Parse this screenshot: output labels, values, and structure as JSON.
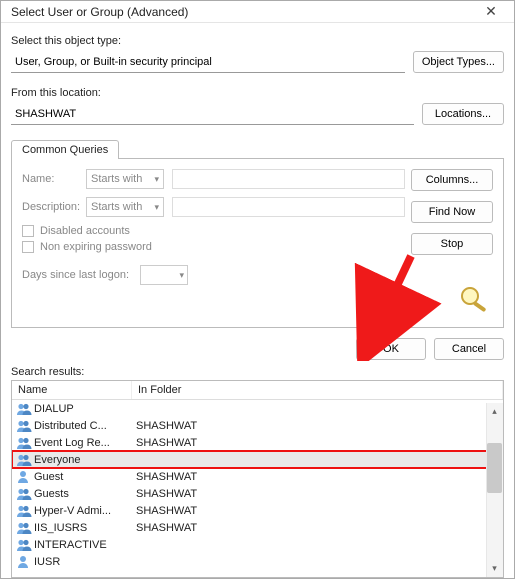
{
  "title": "Select User or Group (Advanced)",
  "labels": {
    "object_type": "Select this object type:",
    "from_location": "From this location:",
    "common_queries_tab": "Common Queries",
    "name": "Name:",
    "description": "Description:",
    "starts_with": "Starts with",
    "disabled_accounts": "Disabled accounts",
    "non_expiring": "Non expiring password",
    "days_since": "Days since last logon:",
    "search_results": "Search results:",
    "col_name": "Name",
    "col_folder": "In Folder"
  },
  "values": {
    "object_type": "User, Group, or Built-in security principal",
    "location": "SHASHWAT"
  },
  "buttons": {
    "object_types": "Object Types...",
    "locations": "Locations...",
    "columns": "Columns...",
    "find_now": "Find Now",
    "stop": "Stop",
    "ok": "OK",
    "cancel": "Cancel"
  },
  "results": [
    {
      "name": "DIALUP",
      "folder": "",
      "icon": "group",
      "selected": false,
      "highlight": false
    },
    {
      "name": "Distributed C...",
      "folder": "SHASHWAT",
      "icon": "group",
      "selected": false,
      "highlight": false
    },
    {
      "name": "Event Log Re...",
      "folder": "SHASHWAT",
      "icon": "group",
      "selected": false,
      "highlight": false
    },
    {
      "name": "Everyone",
      "folder": "",
      "icon": "group",
      "selected": true,
      "highlight": true
    },
    {
      "name": "Guest",
      "folder": "SHASHWAT",
      "icon": "user",
      "selected": false,
      "highlight": false
    },
    {
      "name": "Guests",
      "folder": "SHASHWAT",
      "icon": "group",
      "selected": false,
      "highlight": false
    },
    {
      "name": "Hyper-V Admi...",
      "folder": "SHASHWAT",
      "icon": "group",
      "selected": false,
      "highlight": false
    },
    {
      "name": "IIS_IUSRS",
      "folder": "SHASHWAT",
      "icon": "group",
      "selected": false,
      "highlight": false
    },
    {
      "name": "INTERACTIVE",
      "folder": "",
      "icon": "group",
      "selected": false,
      "highlight": false
    },
    {
      "name": "IUSR",
      "folder": "",
      "icon": "user",
      "selected": false,
      "highlight": false
    }
  ]
}
